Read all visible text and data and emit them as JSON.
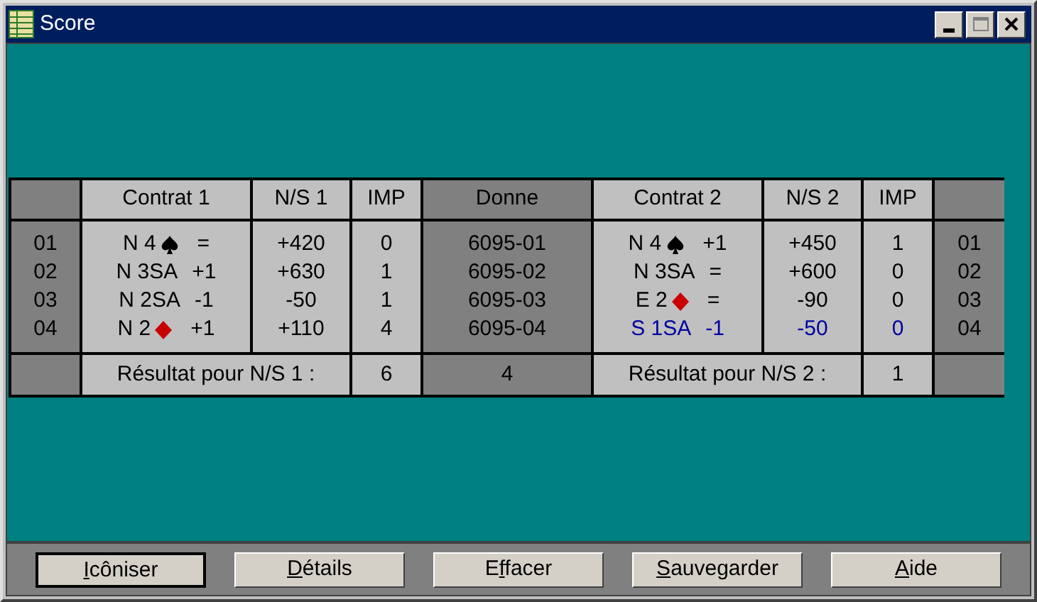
{
  "window": {
    "title": "Score"
  },
  "columns": [
    "",
    "Contrat 1",
    "N/S 1",
    "IMP",
    "Donne",
    "Contrat 2",
    "N/S 2",
    "IMP",
    ""
  ],
  "rows": [
    {
      "board": "01",
      "contract_1": {
        "text": "N 4",
        "kind": "spade",
        "result": "="
      },
      "ns_1": "+420",
      "imp_1": "0",
      "deal": "6095-01",
      "contract_2": {
        "text": "N 4",
        "kind": "spade",
        "result": "+1"
      },
      "ns_2": "+450",
      "imp_2": "1",
      "board_2": "01",
      "side_2_highlighted": false
    },
    {
      "board": "02",
      "contract_1": {
        "text": "N 3SA",
        "kind": "plain",
        "result": "+1"
      },
      "ns_1": "+630",
      "imp_1": "1",
      "deal": "6095-02",
      "contract_2": {
        "text": "N 3SA",
        "kind": "plain",
        "result": "="
      },
      "ns_2": "+600",
      "imp_2": "0",
      "board_2": "02",
      "side_2_highlighted": false
    },
    {
      "board": "03",
      "contract_1": {
        "text": "N 2SA",
        "kind": "plain",
        "result": "-1"
      },
      "ns_1": "-50",
      "imp_1": "1",
      "deal": "6095-03",
      "contract_2": {
        "text": "E 2",
        "kind": "diamond",
        "result": "="
      },
      "ns_2": "-90",
      "imp_2": "0",
      "board_2": "03",
      "side_2_highlighted": false
    },
    {
      "board": "04",
      "contract_1": {
        "text": "N 2",
        "kind": "diamond",
        "result": "+1"
      },
      "ns_1": "+110",
      "imp_1": "4",
      "deal": "6095-04",
      "contract_2": {
        "text": "S 1SA",
        "kind": "plain",
        "result": "-1"
      },
      "ns_2": "-50",
      "imp_2": "0",
      "board_2": "04",
      "side_2_highlighted": true
    }
  ],
  "totals": {
    "label_1": "Résultat pour N/S 1 :",
    "imp_1": "6",
    "deal_total": "4",
    "label_2": "Résultat pour N/S 2 :",
    "imp_2": "1"
  },
  "buttons": [
    {
      "key": "I",
      "rest": "côniser",
      "default": true
    },
    {
      "key": "D",
      "rest": "étails",
      "default": false
    },
    {
      "prefix": "E",
      "key": "f",
      "rest": "facer",
      "default": false
    },
    {
      "key": "S",
      "rest": "auvegarder",
      "default": false
    },
    {
      "key": "A",
      "rest": "ide",
      "default": false
    }
  ]
}
